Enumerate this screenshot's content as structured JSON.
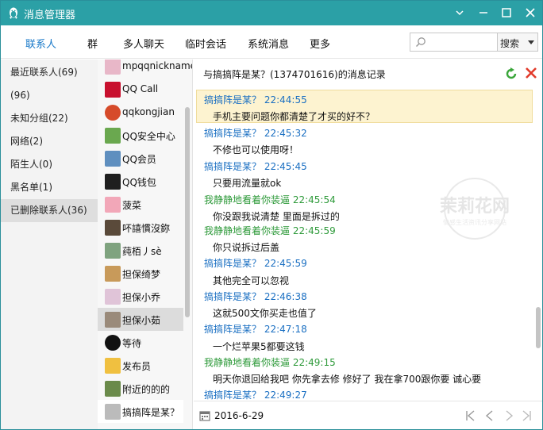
{
  "window": {
    "title": "消息管理器",
    "controls": [
      "minimize-icon",
      "restore-icon",
      "maximize-icon",
      "close-icon"
    ]
  },
  "tabs": [
    {
      "label": "联系人",
      "active": true
    },
    {
      "label": "群",
      "active": false
    },
    {
      "label": "多人聊天",
      "active": false
    },
    {
      "label": "临时会话",
      "active": false
    },
    {
      "label": "系统消息",
      "active": false
    },
    {
      "label": "更多",
      "active": false
    }
  ],
  "search": {
    "value": "",
    "placeholder": "",
    "button_label": "搜索"
  },
  "categories": [
    {
      "label": "最近联系人(69)",
      "selected": false
    },
    {
      "label": "(96)",
      "selected": false
    },
    {
      "label": "未知分组(22)",
      "selected": false
    },
    {
      "label": "网络(2)",
      "selected": false
    },
    {
      "label": "陌生人(0)",
      "selected": false
    },
    {
      "label": "黑名单(1)",
      "selected": false
    },
    {
      "label": "已删除联系人(36)",
      "selected": true
    }
  ],
  "friends": [
    {
      "name": "mpqqnickname",
      "avatar_color": "#e8b7c8",
      "state": ""
    },
    {
      "name": "QQ Call",
      "avatar_color": "#c8102e",
      "state": ""
    },
    {
      "name": "qqkongjian",
      "avatar_color": "#d64b2a",
      "state": ""
    },
    {
      "name": "QQ安全中心",
      "avatar_color": "#6aa84f",
      "state": ""
    },
    {
      "name": "QQ会员",
      "avatar_color": "#5f8fbf",
      "state": ""
    },
    {
      "name": "QQ钱包",
      "avatar_color": "#1f1f1f",
      "state": ""
    },
    {
      "name": "菠菜",
      "avatar_color": "#f2a7b8",
      "state": ""
    },
    {
      "name": "吥譆慣沒鉨",
      "avatar_color": "#5a4a3a",
      "state": ""
    },
    {
      "name": "莼栢丿sè",
      "avatar_color": "#7fa37f",
      "state": ""
    },
    {
      "name": "担保绮梦",
      "avatar_color": "#c89a5a",
      "state": ""
    },
    {
      "name": "担保小乔",
      "avatar_color": "#e0c4d8",
      "state": ""
    },
    {
      "name": "担保小茹",
      "avatar_color": "#9a8a7a",
      "state": "selected"
    },
    {
      "name": "等待",
      "avatar_color": "#111111",
      "state": ""
    },
    {
      "name": "发布员",
      "avatar_color": "#f0c040",
      "state": ""
    },
    {
      "name": "附近的的的",
      "avatar_color": "#6a8a4a",
      "state": ""
    },
    {
      "name": "搞搞阵是某？",
      "avatar_color": "#bbbbbb",
      "state": "current"
    }
  ],
  "conversation": {
    "header": "与搞搞阵是某？(1374701616)的消息记录",
    "messages": [
      {
        "sender": "搞搞阵是某？",
        "time": "22:44:55",
        "text": "手机主要问题你都清楚了才买的好不？",
        "me": false,
        "highlight": true
      },
      {
        "sender": "搞搞阵是某？",
        "time": "22:45:32",
        "text": "不修也可以使用呀！",
        "me": false,
        "highlight": false
      },
      {
        "sender": "搞搞阵是某？",
        "time": "22:45:45",
        "text": "只要用流量就ok",
        "me": false,
        "highlight": false
      },
      {
        "sender": "我静静地看着你装逼",
        "time": "22:45:54",
        "text": "你没跟我说清楚 里面是拆过的",
        "me": true,
        "highlight": false
      },
      {
        "sender": "我静静地看着你装逼",
        "time": "22:45:59",
        "text": "你只说拆过后盖",
        "me": true,
        "highlight": false
      },
      {
        "sender": "搞搞阵是某？",
        "time": "22:45:59",
        "text": "其他完全可以忽视",
        "me": false,
        "highlight": false
      },
      {
        "sender": "搞搞阵是某？",
        "time": "22:46:38",
        "text": "这就500文你买走也值了",
        "me": false,
        "highlight": false
      },
      {
        "sender": "搞搞阵是某？",
        "time": "22:47:18",
        "text": "一个烂苹果5都要这钱",
        "me": false,
        "highlight": false
      },
      {
        "sender": "我静静地看着你装逼",
        "time": "22:49:15",
        "text": "明天你退回给我吧  你先拿去修 修好了 我在拿700跟你要 诚心要",
        "me": true,
        "highlight": false
      },
      {
        "sender": "搞搞阵是某？",
        "time": "22:49:27",
        "text": "",
        "me": false,
        "highlight": false
      }
    ]
  },
  "footer": {
    "date": "2016-6-29",
    "nav_icons": [
      "first-page-icon",
      "prev-page-icon",
      "next-page-icon",
      "last-page-icon"
    ]
  },
  "watermark": {
    "title": "茉莉花网",
    "subtitle": "情感生活资讯分享网站"
  },
  "colors": {
    "titlebar": "#2ba0a6",
    "active_tab": "#1979c9",
    "contact_name": "#1a6fc2",
    "my_name": "#2e9a3a",
    "highlight": "#fdf3d0"
  }
}
